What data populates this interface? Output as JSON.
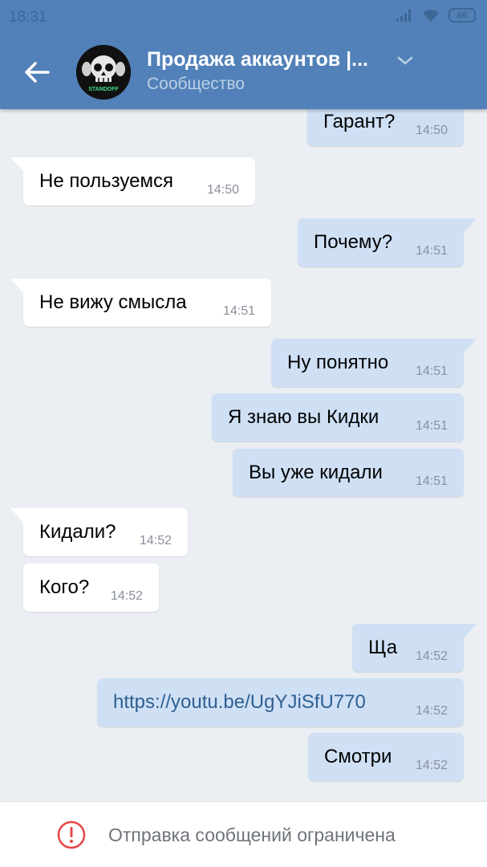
{
  "status_bar": {
    "time": "18:31",
    "battery": "86"
  },
  "header": {
    "title": "Продажа аккаунтов |...",
    "subtitle": "Сообщество",
    "avatar_text": "STANDOFF",
    "colors": {
      "bar": "#5181b8",
      "title": "#ffffff",
      "subtitle": "#bcd0e6"
    }
  },
  "messages": [
    {
      "dir": "out",
      "text": "Гарант?",
      "time": "14:50"
    },
    {
      "dir": "in",
      "text": "Не пользуемся",
      "time": "14:50"
    },
    {
      "dir": "out",
      "text": "Почему?",
      "time": "14:51"
    },
    {
      "dir": "in",
      "text": "Не вижу смысла",
      "time": "14:51"
    },
    {
      "dir": "out",
      "text": "Ну понятно",
      "time": "14:51"
    },
    {
      "dir": "out",
      "text": "Я знаю вы Кидки",
      "time": "14:51"
    },
    {
      "dir": "out",
      "text": "Вы уже кидали",
      "time": "14:51"
    },
    {
      "dir": "in",
      "text": "Кидали?",
      "time": "14:52"
    },
    {
      "dir": "in",
      "text": "Кого?",
      "time": "14:52"
    },
    {
      "dir": "out",
      "text": "Ща",
      "time": "14:52"
    },
    {
      "dir": "out",
      "text": "https://youtu.be/UgYJiSfU770",
      "time": "14:52",
      "link": true
    },
    {
      "dir": "out",
      "text": "Смотри",
      "time": "14:52"
    }
  ],
  "footer": {
    "notice": "Отправка сообщений ограничена"
  },
  "colors": {
    "incoming_bubble": "#ffffff",
    "outgoing_bubble": "#cfe0f5",
    "link": "#2f5f92",
    "warning": "#e64646"
  }
}
